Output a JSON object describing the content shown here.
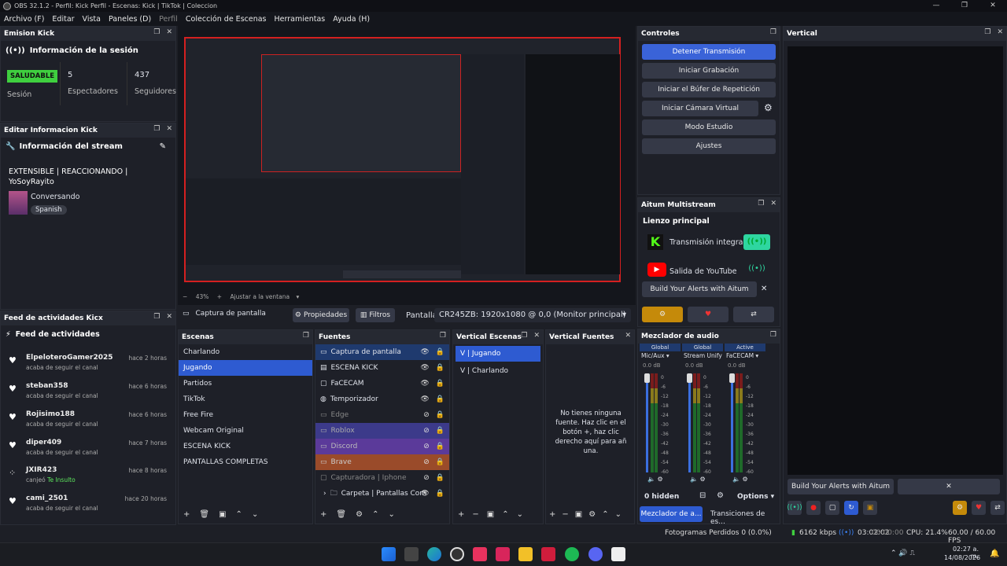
{
  "window": {
    "title": "OBS 32.1.2 - Perfil: Kick Perfil - Escenas: Kick | TikTok | Coleccion",
    "controls": [
      "—",
      "❐",
      "✕"
    ]
  },
  "menu": [
    "Archivo (F)",
    "Editar",
    "Vista",
    "Paneles (D)",
    "Perfil",
    "Colección de Escenas",
    "Herramientas",
    "Ayuda (H)"
  ],
  "emision_kick": {
    "title": "Emision Kick",
    "session_header": "Información de la sesión",
    "status_badge": "SALUDABLE",
    "status_label": "Sesión",
    "viewers_value": "5",
    "viewers_label": "Espectadores",
    "followers_value": "437",
    "followers_label": "Seguidores"
  },
  "editar_info": {
    "title": "Editar Informacion Kick",
    "header": "Información del stream",
    "stream_title": "EXTENSIBLE | REACCIONANDO | YoSoyRayito",
    "category": "Conversando",
    "language": "Spanish"
  },
  "feed": {
    "title": "Feed de actividades Kicx",
    "header": "Feed de actividades",
    "items": [
      {
        "name": "ElpeloteroGamer2025",
        "sub": "acaba de seguir el canal",
        "time": "hace 2 horas",
        "icon": "heart-icon"
      },
      {
        "name": "steban358",
        "sub": "acaba de seguir el canal",
        "time": "hace 6 horas",
        "icon": "heart-icon"
      },
      {
        "name": "Rojisimo188",
        "sub": "acaba de seguir el canal",
        "time": "hace 6 horas",
        "icon": "heart-icon"
      },
      {
        "name": "diper409",
        "sub": "acaba de seguir el canal",
        "time": "hace 7 horas",
        "icon": "heart-icon"
      },
      {
        "name": "JXIR423",
        "sub": "canjeó",
        "sub2": "Te Insulto",
        "time": "hace 8 horas",
        "icon": "redeem-icon"
      },
      {
        "name": "cami_2501",
        "sub": "acaba de seguir el canal",
        "time": "hace 20 horas",
        "icon": "heart-icon"
      }
    ]
  },
  "preview": {
    "zoom": "43%",
    "scale_mode": "Ajustar a la ventana"
  },
  "source_toolbar": {
    "source_name": "Captura de pantalla",
    "props_label": "Propiedades",
    "filters_label": "Filtros",
    "display_label": "Pantalla",
    "display_value": "CR245ZB: 1920x1080 @ 0,0 (Monitor principal)"
  },
  "scenes": {
    "title": "Escenas",
    "items": [
      "Charlando",
      "Jugando",
      "Partidos",
      "TikTok",
      "Free Fire",
      "Webcam Original",
      "ESCENA KICK",
      "PANTALLAS COMPLETAS"
    ],
    "selected": "Jugando"
  },
  "sources": {
    "title": "Fuentes",
    "items": [
      {
        "name": "Captura de pantalla",
        "color": "#1f3a6e",
        "hidden": false
      },
      {
        "name": "ESCENA KICK",
        "color": "",
        "hidden": false
      },
      {
        "name": "FaCECAM",
        "color": "",
        "hidden": false
      },
      {
        "name": "Temporizador",
        "color": "",
        "hidden": false
      },
      {
        "name": "Edge",
        "color": "",
        "hidden": true
      },
      {
        "name": "Roblox",
        "color": "#3c3a8a",
        "hidden": true
      },
      {
        "name": "Discord",
        "color": "#5b3a9a",
        "hidden": true
      },
      {
        "name": "Brave",
        "color": "#9a4b2a",
        "hidden": true
      },
      {
        "name": "Capturadora | Iphone",
        "color": "",
        "hidden": true
      },
      {
        "name": "Carpeta | Pantallas Com",
        "color": "",
        "hidden": false
      }
    ]
  },
  "vertical_scenes": {
    "title": "Vertical Escenas",
    "items": [
      "V | Jugando",
      "V | Charlando"
    ]
  },
  "vertical_sources": {
    "title": "Vertical Fuentes",
    "empty_text": "No tienes ninguna fuente. Haz clic en el botón +, haz clic derecho aquí para añ una."
  },
  "controls": {
    "title": "Controles",
    "buttons": [
      "Detener Transmisión",
      "Iniciar Grabación",
      "Iniciar el Búfer de Repetición",
      "Iniciar Cámara Virtual",
      "Modo Estudio",
      "Ajustes"
    ]
  },
  "multistream": {
    "title": "Aitum Multistream",
    "canvas_label": "Lienzo principal",
    "outputs": [
      "Transmisión integrada",
      "Salida de YouTube"
    ],
    "promo": "Build Your Alerts with Aitum"
  },
  "vertical": {
    "title": "Vertical",
    "promo": "Build Your Alerts with Aitum"
  },
  "mixer": {
    "title": "Mezclador de audio",
    "channels": [
      {
        "scope": "Global",
        "name": "Mic/Aux",
        "db": "0.0 dB"
      },
      {
        "scope": "Global",
        "name": "Stream Unify",
        "db": "0.0 dB"
      },
      {
        "scope": "Active",
        "name": "FaCECAM",
        "db": "0.0 dB"
      }
    ],
    "scale": [
      "0",
      "-6",
      "-12",
      "-18",
      "-24",
      "-30",
      "-36",
      "-42",
      "-48",
      "-54",
      "-60"
    ],
    "hidden_label": "0 hidden",
    "options_label": "Options",
    "tabs": [
      "Mezclador de a...",
      "Transiciones de es..."
    ]
  },
  "status": {
    "dropped": "Fotogramas Perdidos 0 (0.0%)",
    "bitrate": "6162 kbps",
    "stream_time": "03:02:02",
    "rec_time": "00:00:00",
    "cpu": "CPU: 21.4%",
    "fps": "60.00 / 60.00 FPS"
  },
  "taskbar": {
    "time": "02:27 a. m.",
    "date": "14/08/2026"
  }
}
